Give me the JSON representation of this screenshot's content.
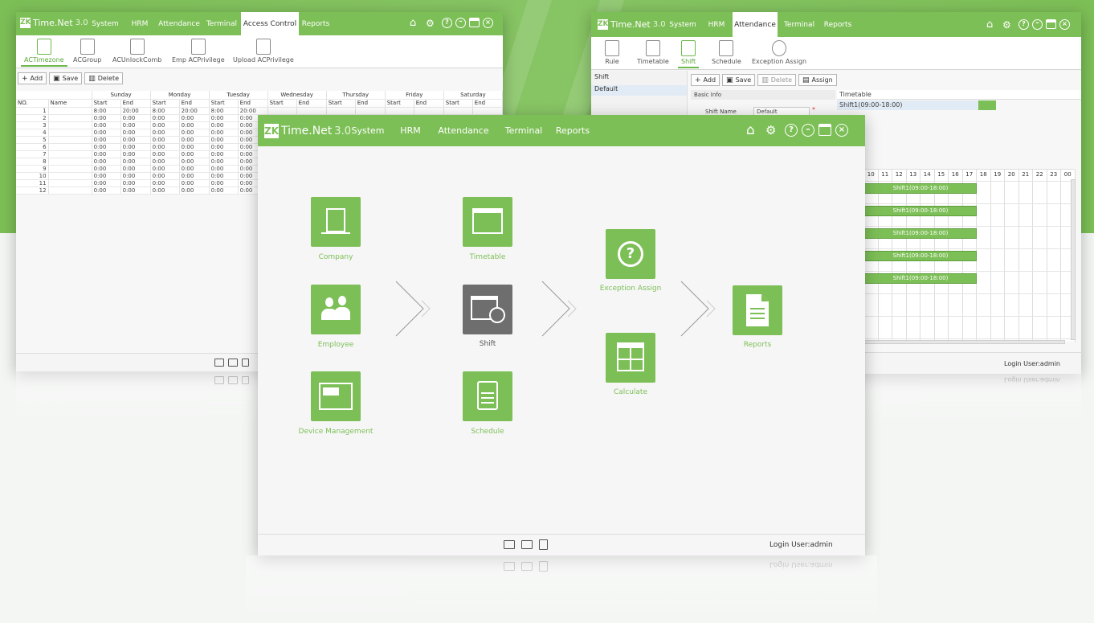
{
  "app": {
    "logo_mark": "ZK",
    "logo_name": "Time.Net",
    "logo_version": "3.0"
  },
  "colors": {
    "brand_green": "#7dbf57",
    "dark_tile": "#6e6e6e",
    "background": "#f4f6f4"
  },
  "left_window": {
    "menu": [
      "System",
      "HRM",
      "Attendance",
      "Terminal",
      "Access Control",
      "Reports"
    ],
    "active_menu": "Access Control",
    "ribbon": [
      "ACTimezone",
      "ACGroup",
      "ACUnlockComb",
      "Emp ACPrivilege",
      "Upload ACPrivilege"
    ],
    "active_ribbon": "ACTimezone",
    "toolbar": {
      "add": "Add",
      "save": "Save",
      "delete": "Delete"
    },
    "days": [
      "Sunday",
      "Monday",
      "Tuesday",
      "Wednesday",
      "Thursday",
      "Friday",
      "Saturday"
    ],
    "col_no": "NO.",
    "col_name": "Name",
    "col_start": "Start",
    "col_end": "End",
    "rows": [
      {
        "no": "1",
        "cells": [
          "8:00",
          "20:00",
          "8:00",
          "20:00",
          "8:00",
          "20:00"
        ]
      },
      {
        "no": "2",
        "cells": [
          "0:00",
          "0:00",
          "0:00",
          "0:00",
          "0:00",
          "0:00"
        ]
      },
      {
        "no": "3",
        "cells": [
          "0:00",
          "0:00",
          "0:00",
          "0:00",
          "0:00",
          "0:00"
        ]
      },
      {
        "no": "4",
        "cells": [
          "0:00",
          "0:00",
          "0:00",
          "0:00",
          "0:00",
          "0:00"
        ]
      },
      {
        "no": "5",
        "cells": [
          "0:00",
          "0:00",
          "0:00",
          "0:00",
          "0:00",
          "0:00"
        ]
      },
      {
        "no": "6",
        "cells": [
          "0:00",
          "0:00",
          "0:00",
          "0:00",
          "0:00",
          "0:00"
        ]
      },
      {
        "no": "7",
        "cells": [
          "0:00",
          "0:00",
          "0:00",
          "0:00",
          "0:00",
          "0:00"
        ]
      },
      {
        "no": "8",
        "cells": [
          "0:00",
          "0:00",
          "0:00",
          "0:00",
          "0:00",
          "0:00"
        ]
      },
      {
        "no": "9",
        "cells": [
          "0:00",
          "0:00",
          "0:00",
          "0:00",
          "0:00",
          "0:00"
        ]
      },
      {
        "no": "10",
        "cells": [
          "0:00",
          "0:00",
          "0:00",
          "0:00",
          "0:00",
          "0:00"
        ]
      },
      {
        "no": "11",
        "cells": [
          "0:00",
          "0:00",
          "0:00",
          "0:00",
          "0:00",
          "0:00"
        ]
      },
      {
        "no": "12",
        "cells": [
          "0:00",
          "0:00",
          "0:00",
          "0:00",
          "0:00",
          "0:00"
        ]
      }
    ]
  },
  "right_window": {
    "menu": [
      "System",
      "HRM",
      "Attendance",
      "Terminal",
      "Reports"
    ],
    "active_menu": "Attendance",
    "ribbon": [
      "Rule",
      "Timetable",
      "Shift",
      "Schedule",
      "Exception Assign"
    ],
    "active_ribbon": "Shift",
    "toolbar": {
      "add": "Add",
      "save": "Save",
      "delete": "Delete",
      "assign": "Assign"
    },
    "left_header": "Shift",
    "left_item": "Default",
    "basic_info": "Basic Info",
    "shift_name_label": "Shift Name",
    "shift_name_value": "Default",
    "required_mark": "*",
    "timetable_header": "Timetable",
    "timetable_item": "Shift1(09:00-18:00)",
    "hours": [
      "10",
      "11",
      "12",
      "13",
      "14",
      "15",
      "16",
      "17",
      "18",
      "19",
      "20",
      "21",
      "22",
      "23",
      "00"
    ],
    "bars": [
      "Shift1(09:00-18:00)",
      "Shift1(09:00-18:00)",
      "Shift1(09:00-18:00)",
      "Shift1(09:00-18:00)",
      "Shift1(09:00-18:00)"
    ],
    "login_user": "Login User:admin"
  },
  "main_window": {
    "menu": [
      "System",
      "HRM",
      "Attendance",
      "Terminal",
      "Reports"
    ],
    "tiles": {
      "company": "Company",
      "employee": "Employee",
      "device": "Device Management",
      "timetable": "Timetable",
      "shift": "Shift",
      "schedule": "Schedule",
      "exception": "Exception Assign",
      "calculate": "Calculate",
      "reports": "Reports"
    },
    "login_user": "Login User:admin",
    "mirror_login_user": "Login User:admin"
  }
}
